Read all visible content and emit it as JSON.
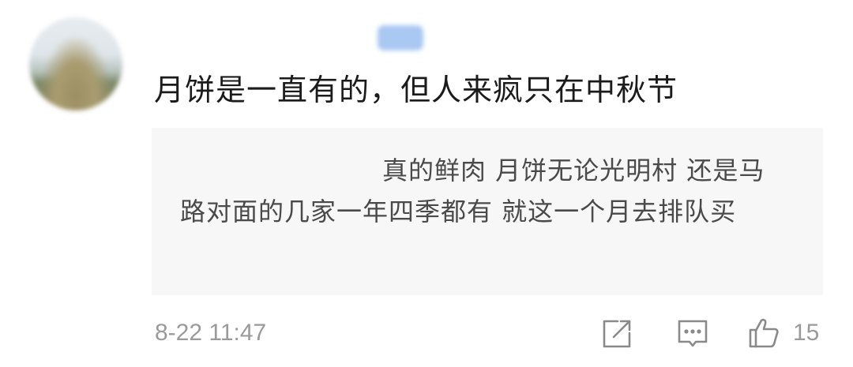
{
  "comment": {
    "username": "",
    "text": "月饼是一直有的，但人来疯只在中秋节",
    "quote": {
      "author": "",
      "text": "真的鲜肉 月饼无论光明村 还是马路对面的几家一年四季都有  就这一个月去排队买"
    },
    "timestamp": "8-22 11:47",
    "like_count": "15"
  },
  "icons": {
    "share": "share-icon",
    "reply": "reply-icon",
    "like": "thumbs-up-icon"
  },
  "colors": {
    "text": "#1b1b1b",
    "muted": "#9a9a9a",
    "quote_bg": "#f7f7f7",
    "badge": "#a9c8f2"
  }
}
